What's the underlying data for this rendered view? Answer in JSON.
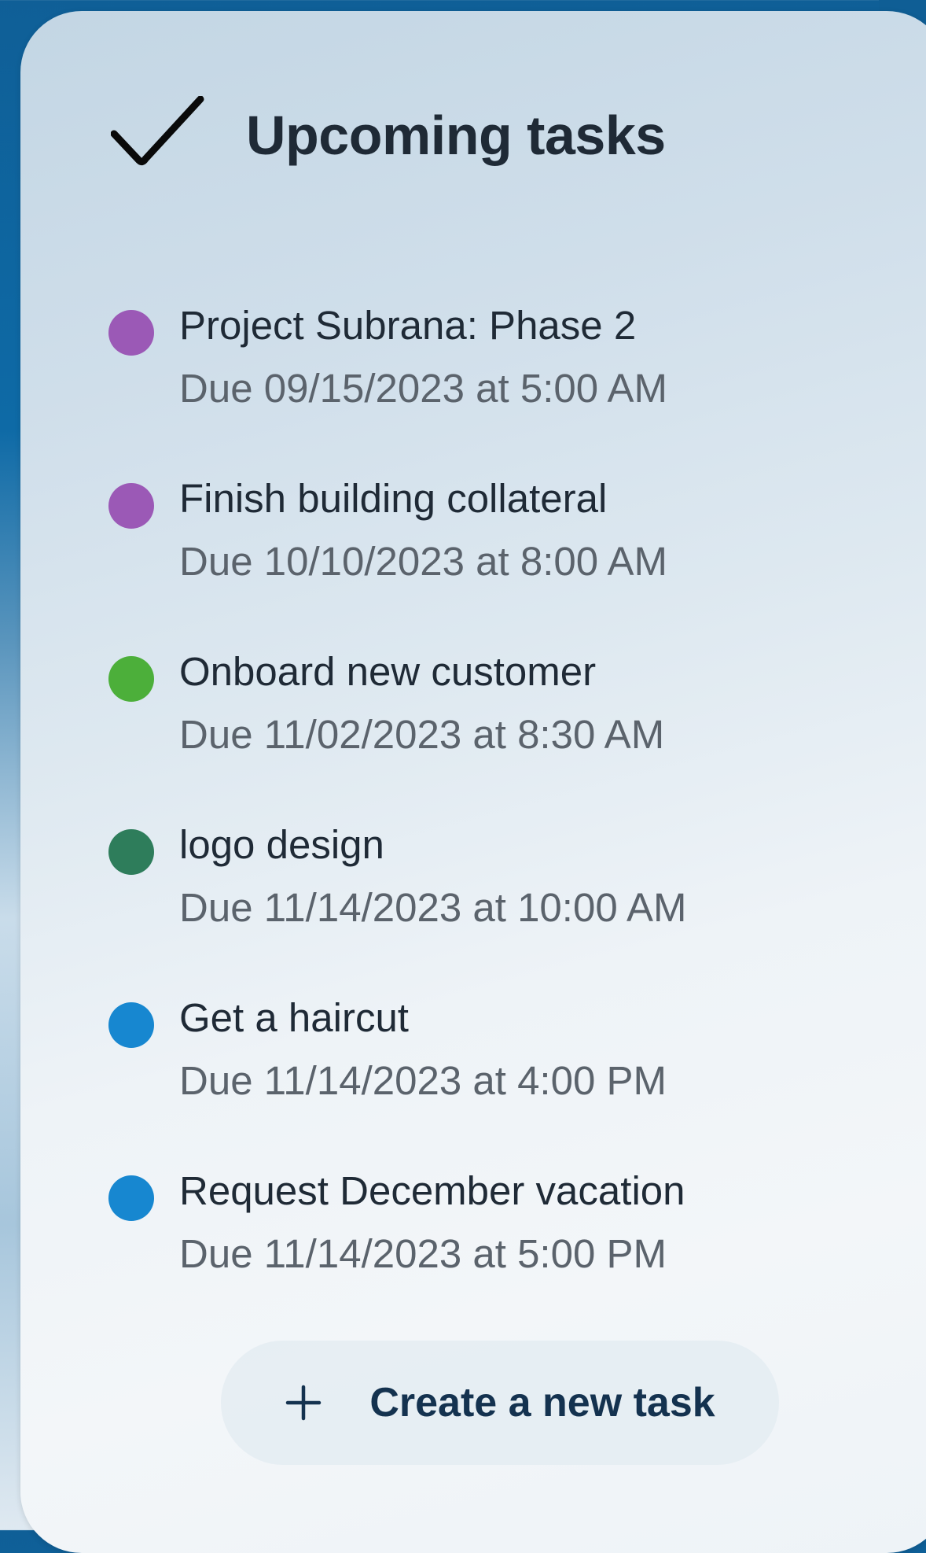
{
  "widget": {
    "title": "Upcoming tasks",
    "header_icon": "checkmark-icon"
  },
  "tasks": [
    {
      "name": "Project Subrana: Phase 2",
      "due": "Due 09/15/2023 at 5:00 AM",
      "color": "#9b59b6"
    },
    {
      "name": "Finish building collateral",
      "due": "Due 10/10/2023 at 8:00 AM",
      "color": "#9b59b6"
    },
    {
      "name": "Onboard new customer",
      "due": "Due 11/02/2023 at 8:30 AM",
      "color": "#4caf3a"
    },
    {
      "name": "logo design",
      "due": "Due 11/14/2023 at 10:00 AM",
      "color": "#2e7d5b"
    },
    {
      "name": "Get a haircut",
      "due": "Due 11/14/2023 at 4:00 PM",
      "color": "#1787d0"
    },
    {
      "name": "Request December vacation",
      "due": "Due 11/14/2023 at 5:00 PM",
      "color": "#1787d0"
    }
  ],
  "create_button": {
    "label": "Create a new task",
    "icon": "plus-icon"
  }
}
